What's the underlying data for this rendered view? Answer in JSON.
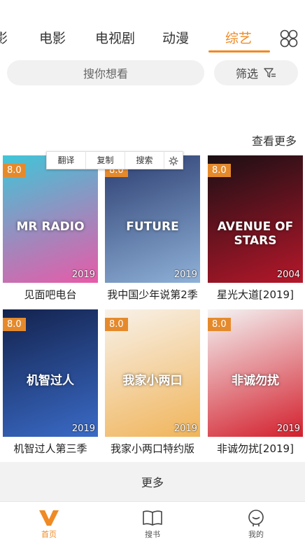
{
  "tabs": [
    {
      "label": "影"
    },
    {
      "label": "电影"
    },
    {
      "label": "电视剧"
    },
    {
      "label": "动漫"
    },
    {
      "label": "综艺"
    }
  ],
  "active_tab_index": 4,
  "search": {
    "placeholder": "搜你想看"
  },
  "filter": {
    "label": "筛选"
  },
  "section": {
    "more_label": "查看更多"
  },
  "selection_popup": {
    "translate": "翻译",
    "copy": "复制",
    "search": "搜索"
  },
  "items": [
    {
      "title": "见面吧电台",
      "rating": "8.0",
      "year": "2019",
      "poster_colors": [
        "#3fc6d8",
        "#e85aa8"
      ],
      "poster_text": "MR RADIO"
    },
    {
      "title": "我中国少年说第2季",
      "rating": "8.0",
      "year": "2019",
      "poster_colors": [
        "#2b3d70",
        "#8fb1d8"
      ],
      "poster_text": "FUTURE"
    },
    {
      "title": "星光大道[2019]",
      "rating": "8.0",
      "year": "2004",
      "poster_colors": [
        "#1a0f14",
        "#b5172a"
      ],
      "poster_text": "AVENUE OF STARS"
    },
    {
      "title": "机智过人第三季",
      "rating": "8.0",
      "year": "2019",
      "poster_colors": [
        "#13224d",
        "#3a6bc7"
      ],
      "poster_text": "机智过人"
    },
    {
      "title": "我家小两口特约版",
      "rating": "8.0",
      "year": "2019",
      "poster_colors": [
        "#f8f2ea",
        "#f0b45a"
      ],
      "poster_text": "我家小两口"
    },
    {
      "title": "非诚勿扰[2019]",
      "rating": "8.0",
      "year": "2019",
      "poster_colors": [
        "#f4f4f4",
        "#d31f2c"
      ],
      "poster_text": "非诚勿扰"
    }
  ],
  "more_bar": {
    "label": "更多"
  },
  "bottom_nav": [
    {
      "label": "首页",
      "icon": "v-logo-icon"
    },
    {
      "label": "搜书",
      "icon": "book-icon"
    },
    {
      "label": "我的",
      "icon": "profile-icon"
    }
  ],
  "colors": {
    "accent": "#f08a24",
    "rating_badge": "#e58a2c"
  }
}
